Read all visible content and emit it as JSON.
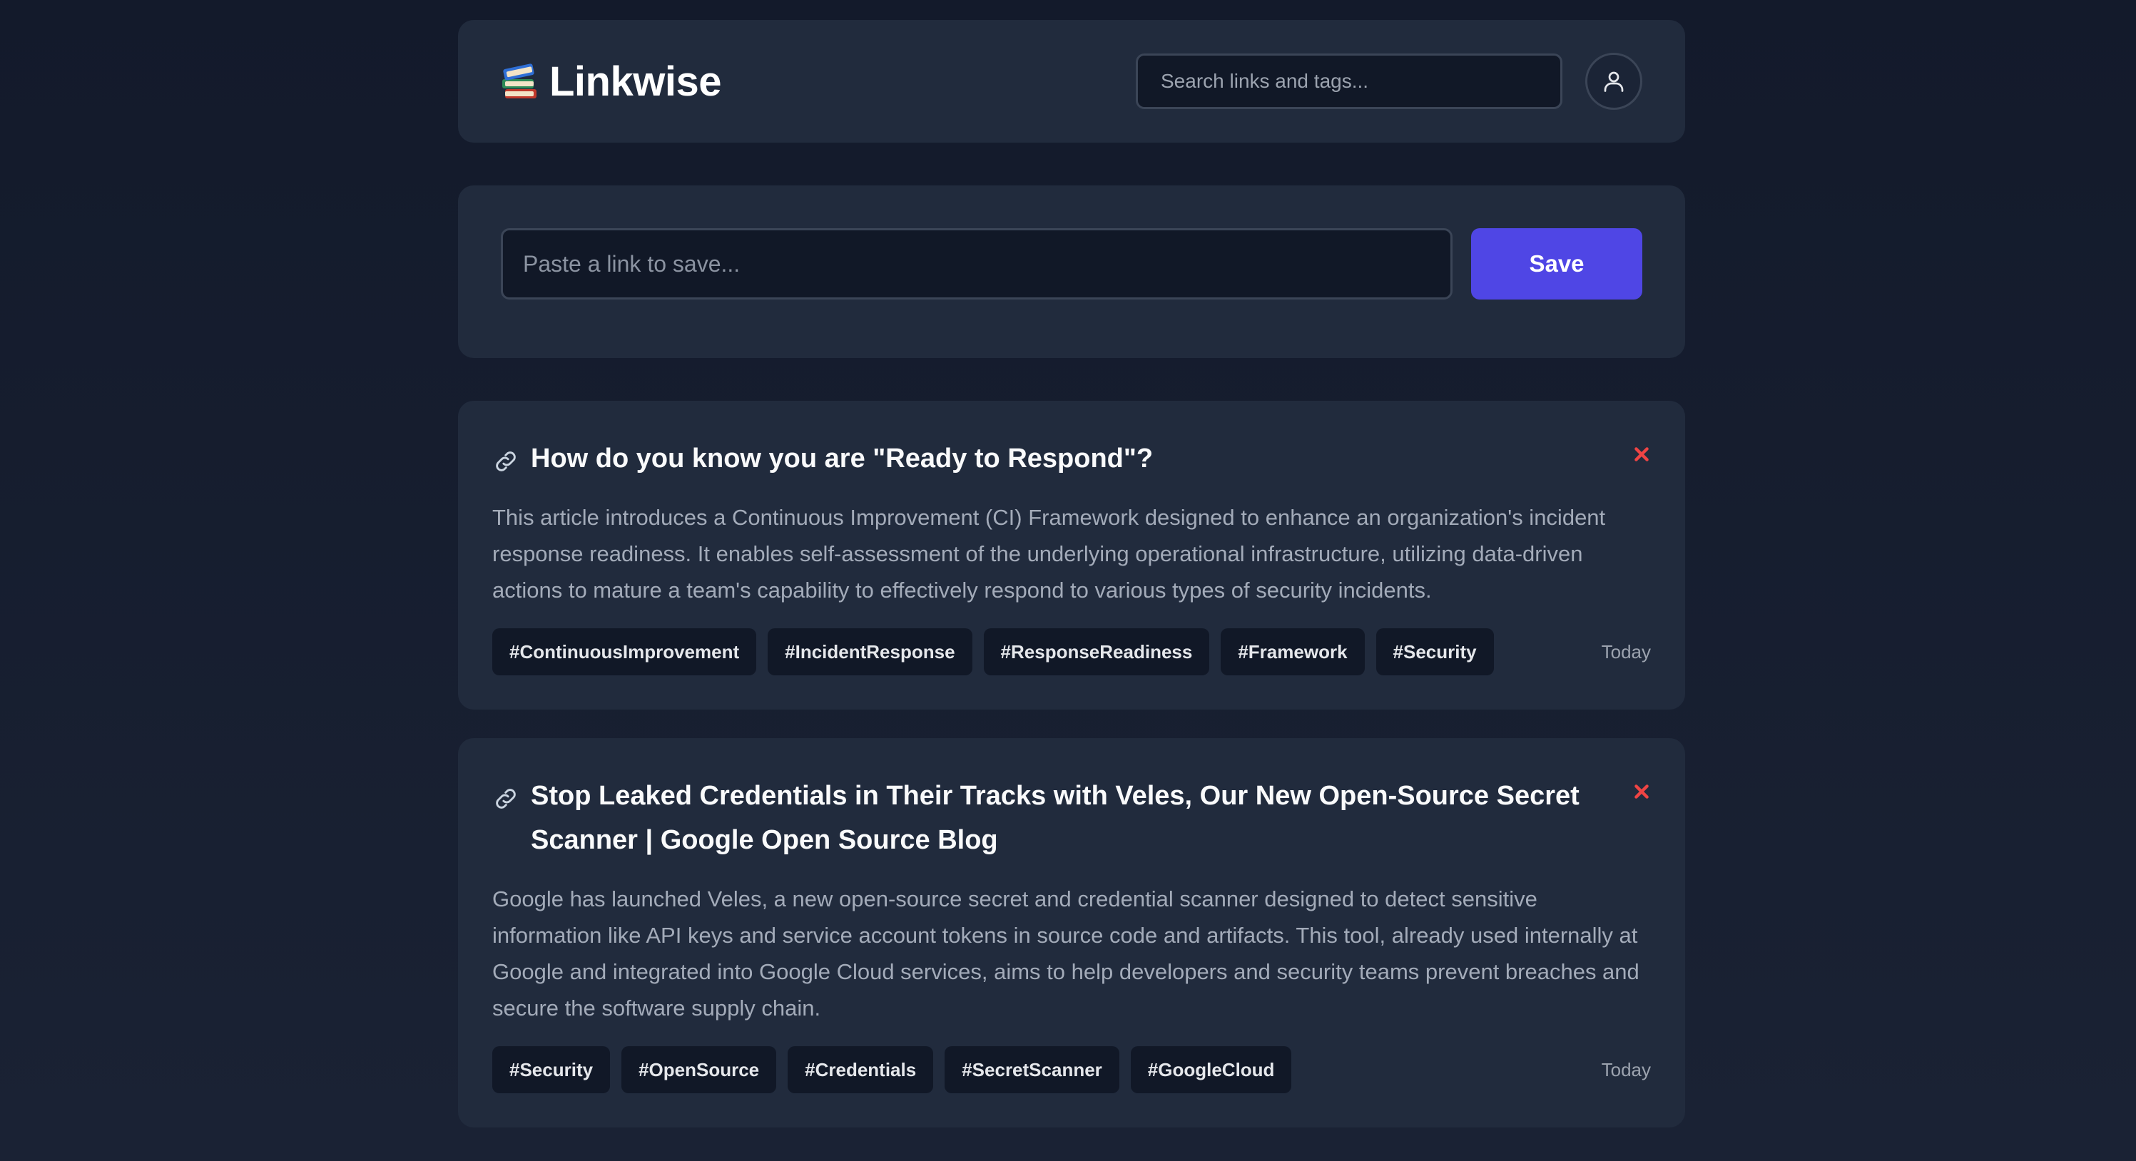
{
  "app": {
    "name": "Linkwise",
    "logo_icon": "books-icon"
  },
  "search": {
    "placeholder": "Search links and tags...",
    "value": ""
  },
  "user_menu": {
    "icon": "user-icon"
  },
  "save_form": {
    "placeholder": "Paste a link to save...",
    "value": "",
    "button_label": "Save"
  },
  "links": [
    {
      "title": "How do you know you are \"Ready to Respond\"?",
      "description": "This article introduces a Continuous Improvement (CI) Framework designed to enhance an organization's incident response readiness. It enables self-assessment of the underlying operational infrastructure, utilizing data-driven actions to mature a team's capability to effectively respond to various types of security incidents.",
      "tags": [
        "#ContinuousImprovement",
        "#IncidentResponse",
        "#ResponseReadiness",
        "#Framework",
        "#Security"
      ],
      "date": "Today"
    },
    {
      "title": "Stop Leaked Credentials in Their Tracks with Veles, Our New Open-Source Secret Scanner | Google Open Source Blog",
      "description": "Google has launched Veles, a new open-source secret and credential scanner designed to detect sensitive information like API keys and service account tokens in source code and artifacts. This tool, already used internally at Google and integrated into Google Cloud services, aims to help developers and security teams prevent breaches and secure the software supply chain.",
      "tags": [
        "#Security",
        "#OpenSource",
        "#Credentials",
        "#SecretScanner",
        "#GoogleCloud"
      ],
      "date": "Today"
    }
  ],
  "colors": {
    "accent": "#4f46e5",
    "delete": "#ef4444",
    "panel": "#212b3d",
    "background": "#161e30"
  }
}
